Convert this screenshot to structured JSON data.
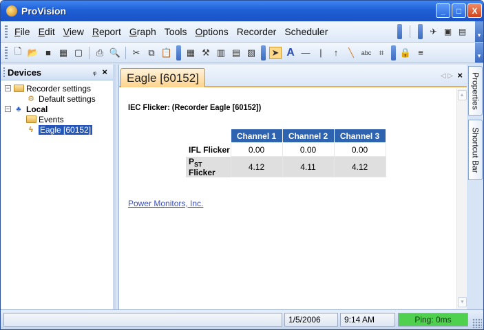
{
  "window": {
    "title": "ProVision",
    "controls": {
      "minimize": "_",
      "maximize": "□",
      "close": "X"
    }
  },
  "menubar": {
    "items": [
      {
        "label": "File",
        "underline": "F",
        "rest": "ile"
      },
      {
        "label": "Edit",
        "underline": "E",
        "rest": "dit"
      },
      {
        "label": "View",
        "underline": "V",
        "rest": "iew"
      },
      {
        "label": "Report",
        "underline": "R",
        "rest": "eport"
      },
      {
        "label": "Graph",
        "underline": "G",
        "rest": "raph"
      },
      {
        "label": "Tools",
        "underline": "",
        "rest": "Tools"
      },
      {
        "label": "Options",
        "underline": "O",
        "rest": "ptions"
      },
      {
        "label": "Recorder",
        "underline": "",
        "rest": "Recorder"
      },
      {
        "label": "Scheduler",
        "underline": "",
        "rest": "Scheduler"
      }
    ]
  },
  "devices_panel": {
    "title": "Devices",
    "pin_glyph": "ᵩ",
    "close_glyph": "×",
    "tree": {
      "recorder_settings": "Recorder settings",
      "default_settings": "Default settings",
      "local": "Local",
      "events": "Events",
      "eagle": "Eagle [60152]"
    }
  },
  "document": {
    "tab_label": "Eagle [60152]",
    "heading": "IEC Flicker: (Recorder Eagle [60152])",
    "table": {
      "columns": [
        "Channel 1",
        "Channel 2",
        "Channel 3"
      ],
      "rows": [
        {
          "label": "IFL Flicker",
          "values": [
            "0.00",
            "0.00",
            "0.00"
          ]
        },
        {
          "label_main": "P",
          "label_sub": "ST",
          "label_rest": " Flicker",
          "values": [
            "4.12",
            "4.11",
            "4.12"
          ]
        }
      ]
    },
    "link_text": "Power Monitors, Inc."
  },
  "side_tabs": {
    "properties": "Properties",
    "shortcut_bar": "Shortcut Bar"
  },
  "statusbar": {
    "date": "1/5/2006",
    "time": "9:14 AM",
    "ping": "Ping: 0ms"
  },
  "colors": {
    "title_blue": "#1f5fd6",
    "table_header": "#2e63b0",
    "tab_orange": "#ffd28c",
    "ping_green": "#4fd04f"
  }
}
